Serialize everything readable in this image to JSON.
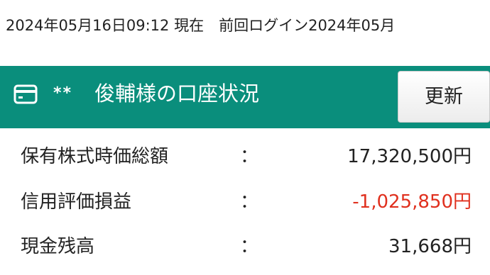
{
  "timestamp": {
    "text": "2024年05月16日09:12 現在　前回ログイン2024年05月"
  },
  "panel": {
    "masked_name": "**",
    "title": "俊輔様の口座状況",
    "refresh_label": "更新",
    "header_color": "#0a8e7c",
    "icon": "card-icon"
  },
  "rows": [
    {
      "label": "保有株式時価総額",
      "colon": "：",
      "value": "17,320,500円"
    },
    {
      "label": "信用評価損益",
      "colon": "：",
      "value": "-1,025,850円",
      "color": "#e0301e"
    },
    {
      "label": "現金残高",
      "colon": "：",
      "value": "31,668円"
    }
  ]
}
